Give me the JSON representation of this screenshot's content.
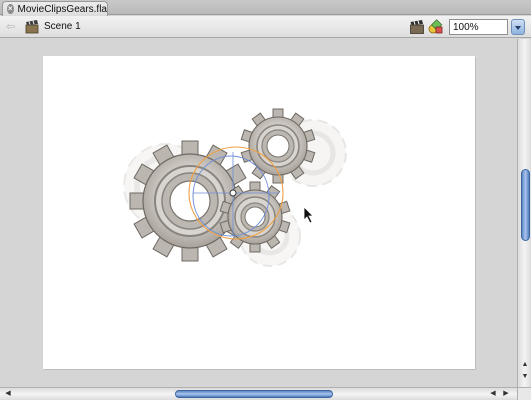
{
  "tab": {
    "title": "MovieClipsGears.fla",
    "close_glyph": "×"
  },
  "editbar": {
    "back_glyph": "⇦",
    "scene_label": "Scene 1",
    "zoom_value": "100%"
  },
  "icons": {
    "scene": "clapperboard-icon",
    "edit_scene": "edit-scene-icon",
    "edit_symbols": "edit-symbols-icon"
  },
  "colors": {
    "accent": "#5d86c4",
    "gear_fill": "#c6c2bd",
    "gear_stroke": "#7c7670",
    "transform_orange": "#f0a044",
    "transform_blue": "#6f8fd8"
  }
}
